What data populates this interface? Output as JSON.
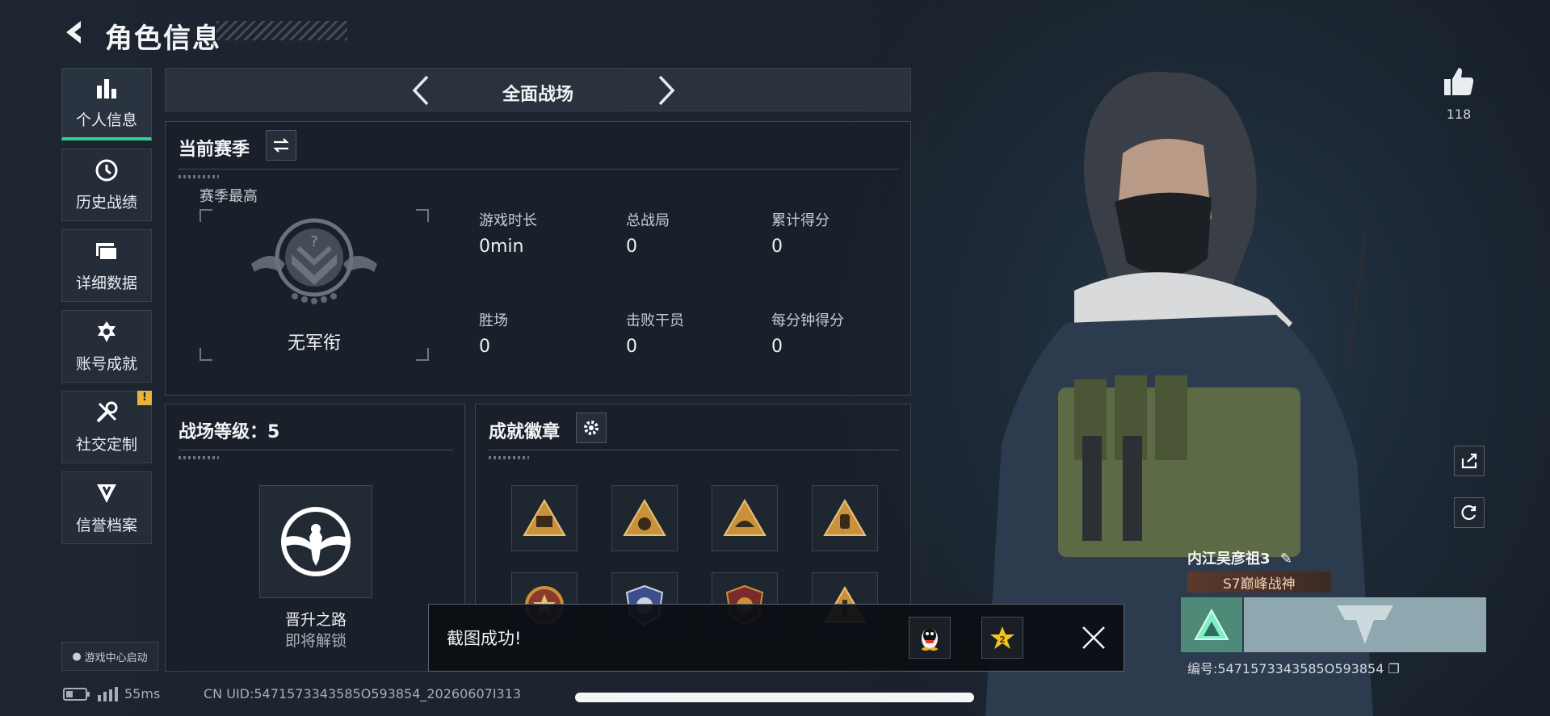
{
  "header": {
    "title": "角色信息"
  },
  "sidebar": {
    "items": [
      {
        "label": "个人信息",
        "icon": "bar-chart-icon",
        "active": true
      },
      {
        "label": "历史战绩",
        "icon": "clock-icon"
      },
      {
        "label": "详细数据",
        "icon": "folder-icon"
      },
      {
        "label": "账号成就",
        "icon": "achievement-icon"
      },
      {
        "label": "社交定制",
        "icon": "tools-icon",
        "badge": "!"
      },
      {
        "label": "信誉档案",
        "icon": "credit-icon"
      }
    ],
    "game_center": "游戏中心启动"
  },
  "mode": {
    "title": "全面战场"
  },
  "season": {
    "title": "当前赛季",
    "best_label": "赛季最高",
    "rank_name": "无军衔",
    "stats": [
      {
        "label": "游戏时长",
        "value": "0min"
      },
      {
        "label": "总战局",
        "value": "0"
      },
      {
        "label": "累计得分",
        "value": "0"
      },
      {
        "label": "胜场",
        "value": "0"
      },
      {
        "label": "击败干员",
        "value": "0"
      },
      {
        "label": "每分钟得分",
        "value": "0"
      }
    ]
  },
  "level": {
    "title": "战场等级：5",
    "path_title": "晋升之路",
    "path_status": "即将解锁"
  },
  "badges": {
    "title": "成就徽章"
  },
  "toast": {
    "text": "截图成功!"
  },
  "status_bar": {
    "ping": "55ms",
    "uid": "CN UID:5471573343585O593854_20260607I313"
  },
  "profile": {
    "likes": "118",
    "name": "内江吴彦祖3",
    "title": "S7巅峰战神",
    "id": "编号:5471573343585O593854"
  },
  "colors": {
    "accent": "#2fd28d",
    "warning": "#e6b43a",
    "badge_gold": "#c9913a"
  }
}
